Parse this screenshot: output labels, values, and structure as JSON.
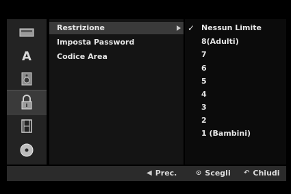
{
  "left_icons": [
    {
      "icon": "disc-tray-icon"
    },
    {
      "icon": "language-a-icon"
    },
    {
      "icon": "speaker-icon"
    },
    {
      "icon": "lock-icon",
      "active": true
    },
    {
      "icon": "film-strip-icon"
    },
    {
      "icon": "disc-icon"
    }
  ],
  "menu": {
    "items": [
      {
        "label": "Restrizione",
        "selected": true
      },
      {
        "label": "Imposta Password"
      },
      {
        "label": "Codice Area"
      }
    ]
  },
  "options": {
    "checked_index": 0,
    "items": [
      {
        "label": "Nessun Limite"
      },
      {
        "label": "8(Adulti)"
      },
      {
        "label": "7"
      },
      {
        "label": "6"
      },
      {
        "label": "5"
      },
      {
        "label": "4"
      },
      {
        "label": "3"
      },
      {
        "label": "2"
      },
      {
        "label": "1 (Bambini)"
      }
    ]
  },
  "footer": {
    "prev_label": "Prec.",
    "select_label": "Scegli",
    "close_label": "Chiudi"
  },
  "colors": {
    "background": "#000000",
    "panel": "#141414",
    "highlight": "#3a3a3a",
    "text": "#e6e6e6"
  }
}
